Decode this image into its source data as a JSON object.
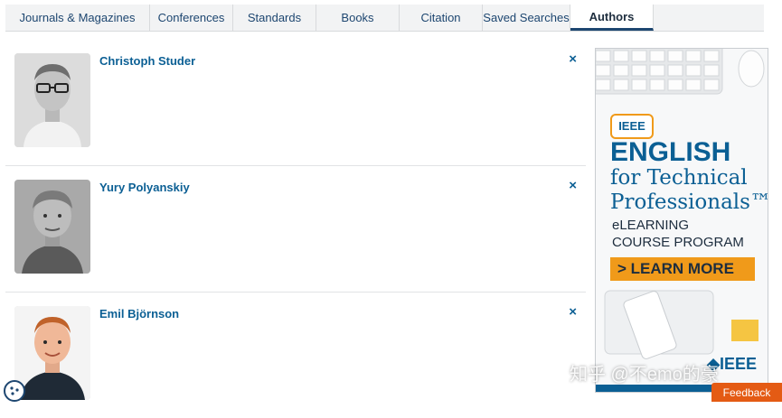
{
  "tabs": [
    {
      "label": "Journals & Magazines"
    },
    {
      "label": "Conferences"
    },
    {
      "label": "Standards"
    },
    {
      "label": "Books"
    },
    {
      "label": "Citation"
    },
    {
      "label": "Saved Searches"
    },
    {
      "label": "Authors"
    }
  ],
  "active_tab": "Authors",
  "authors": [
    {
      "name": "Christoph Studer",
      "remove_label": "×"
    },
    {
      "name": "Yury Polyanskiy",
      "remove_label": "×"
    },
    {
      "name": "Emil Björnson",
      "remove_label": "×"
    }
  ],
  "ad": {
    "badge": "IEEE",
    "line1": "ENGLISH",
    "line2": "for Technical",
    "line3": "Professionals™",
    "line4": "eLEARNING",
    "line5": "COURSE PROGRAM",
    "cta": "> LEARN MORE",
    "logo": "◆IEEE"
  },
  "watermark": "知乎 @不emo的豪",
  "feedback_label": "Feedback",
  "colors": {
    "accent": "#0b5f94",
    "cta": "#f09a1a",
    "feedback": "#e45b14"
  }
}
